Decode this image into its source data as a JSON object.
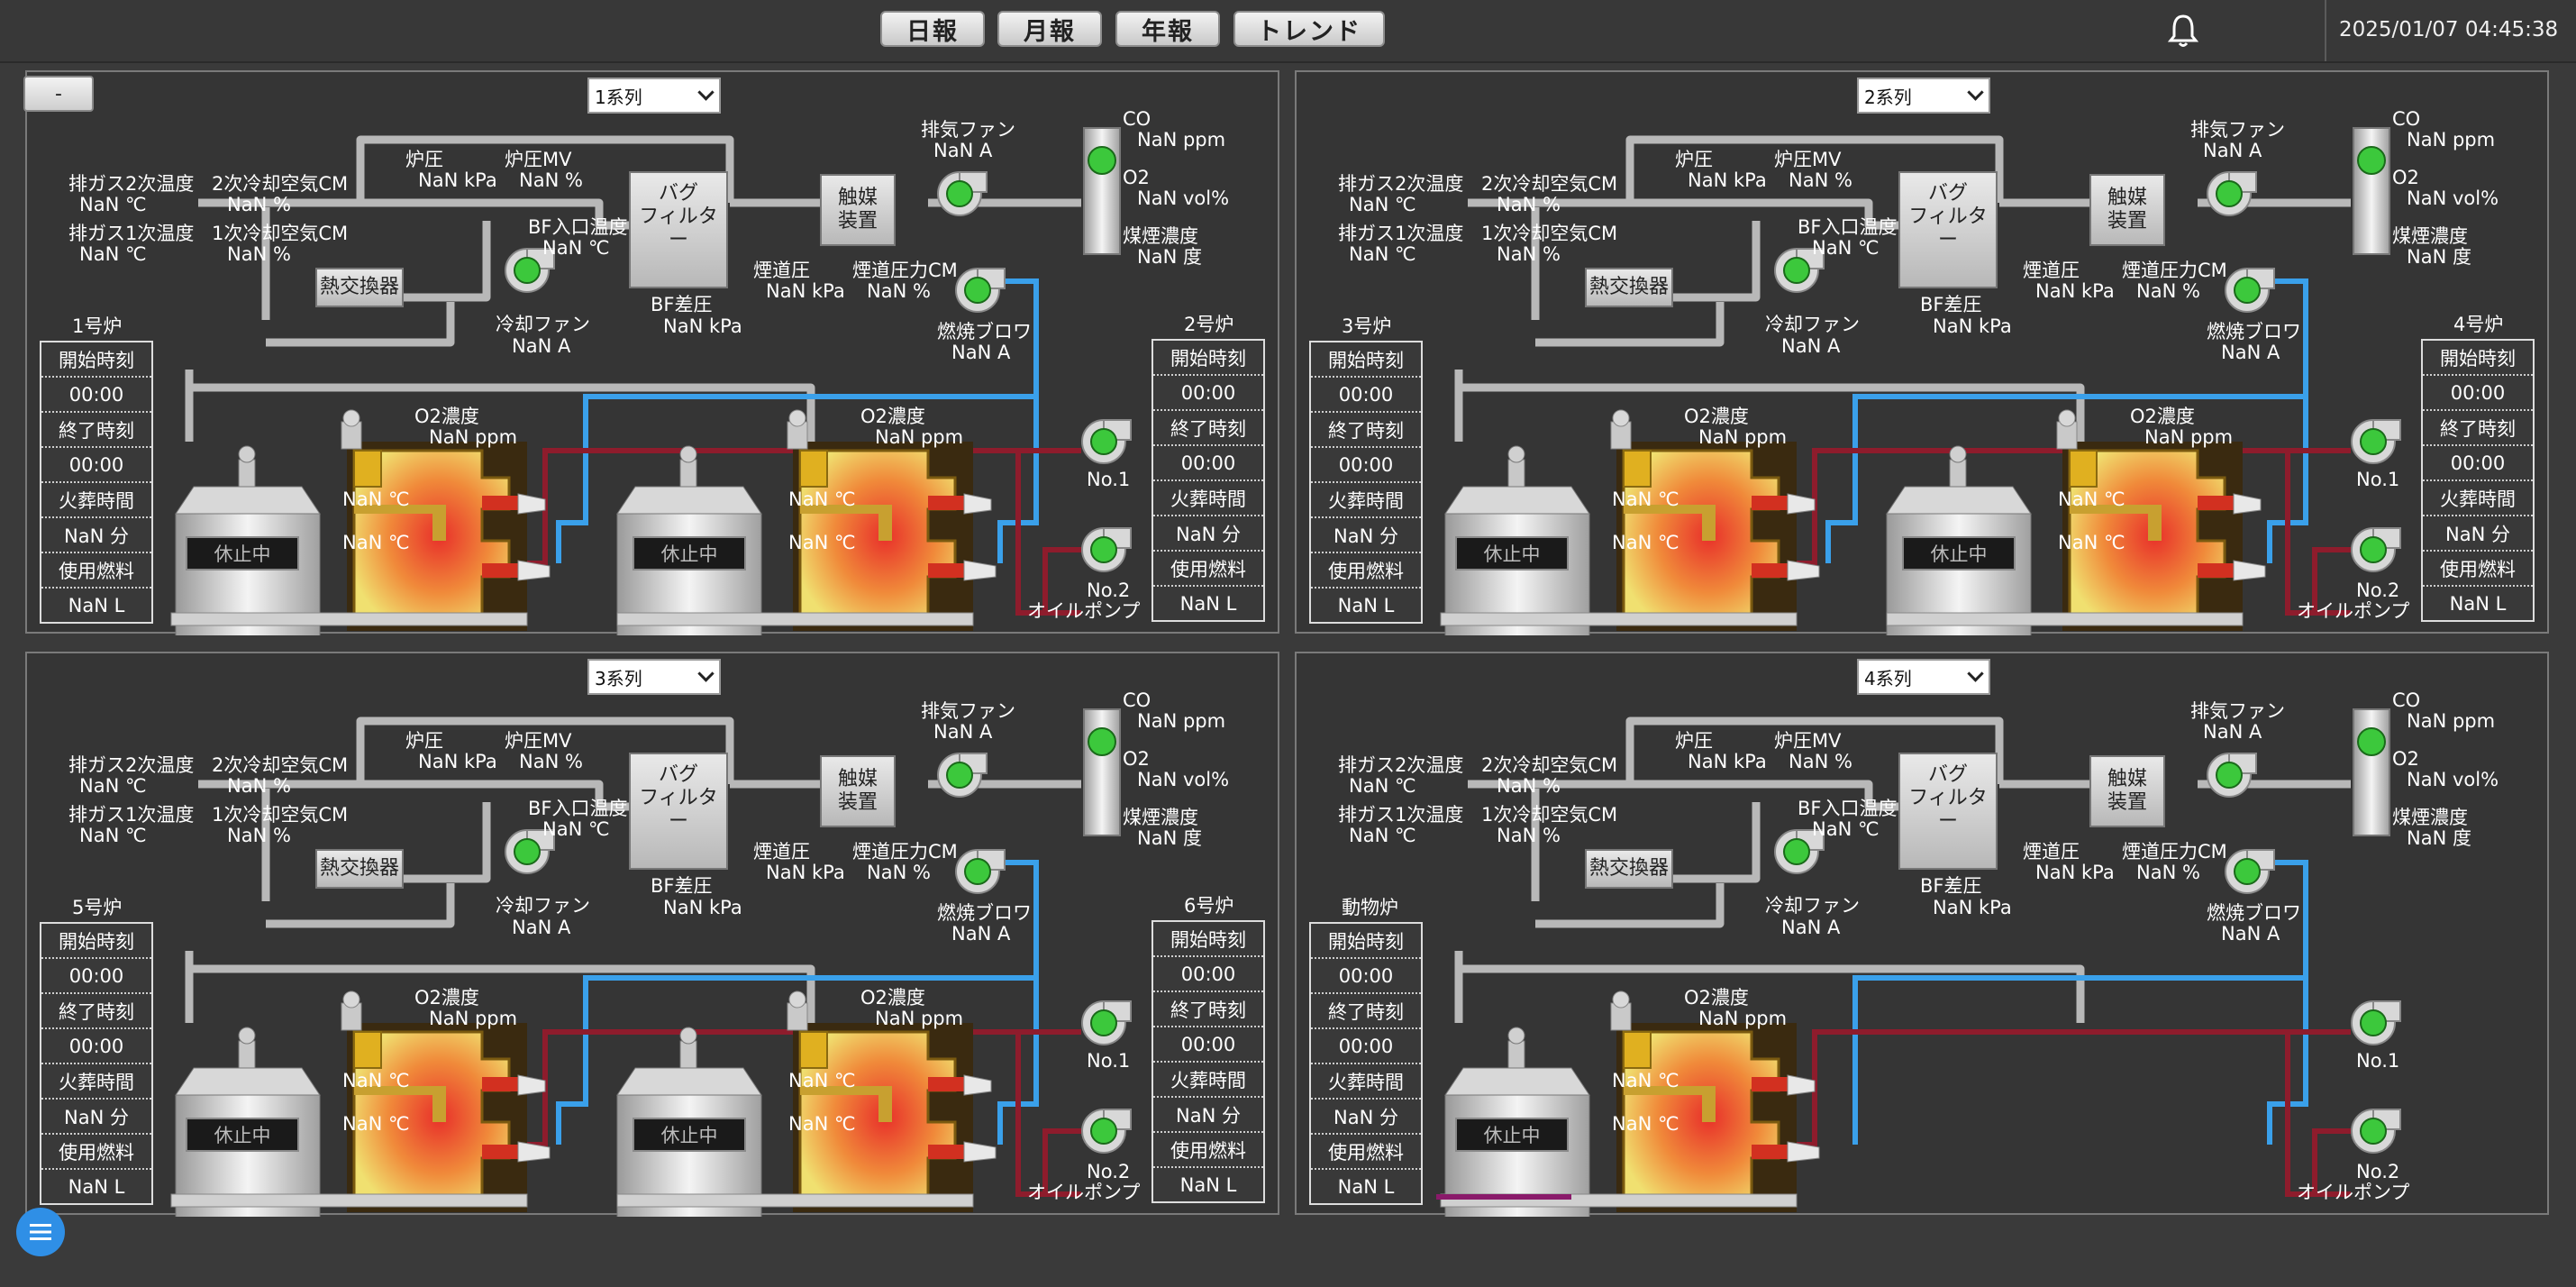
{
  "nav": {
    "daily": "日報",
    "monthly": "月報",
    "yearly": "年報",
    "trend": "トレンド"
  },
  "clock": "2025/01/07 04:45:38",
  "collapse_label": "-",
  "panels": [
    {
      "system": "1系列",
      "left_furnace": "1号炉",
      "right_furnace": "2号炉",
      "has_right_furnace": true
    },
    {
      "system": "2系列",
      "left_furnace": "3号炉",
      "right_furnace": "4号炉",
      "has_right_furnace": true
    },
    {
      "system": "3系列",
      "left_furnace": "5号炉",
      "right_furnace": "6号炉",
      "has_right_furnace": true
    },
    {
      "system": "4系列",
      "left_furnace": "動物炉",
      "right_furnace": "",
      "has_right_furnace": false
    }
  ],
  "labels": {
    "exhaust2_temp": "排ガス2次温度",
    "exhaust1_temp": "排ガス1次温度",
    "cool2_air": "2次冷却空気CM",
    "cool1_air": "1次冷却空気CM",
    "furnace_pressure": "炉圧",
    "furnace_mv": "炉圧MV",
    "bf_inlet_temp": "BF入口温度",
    "bf_diff_pressure": "BF差圧",
    "bag_filter": "バグ\nフィルター",
    "catalyst": "触媒\n装置",
    "heat_exchanger": "熱交換器",
    "exhaust_fan": "排気ファン",
    "cooling_fan": "冷却ファン",
    "flue_pressure": "煙道圧",
    "flue_pressure_cm": "煙道圧力CM",
    "combustion_blower": "燃焼ブロワ",
    "co": "CO",
    "o2": "O2",
    "smoke": "煤煙濃度",
    "o2_conc": "O2濃度",
    "no1": "No.1",
    "no2": "No.2",
    "oil_pump": "オイルポンプ",
    "start_time": "開始時刻",
    "end_time": "終了時刻",
    "burn_time": "火葬時間",
    "fuel": "使用燃料",
    "status_idle": "休止中"
  },
  "values": {
    "temp": "NaN ℃",
    "pct": "NaN %",
    "kpa": "NaN kPa",
    "amp": "NaN A",
    "ppm": "NaN ppm",
    "volpct": "NaN vol%",
    "degree": "NaN 度",
    "time": "00:00",
    "minutes": "NaN 分",
    "liters": "NaN L"
  },
  "colors": {
    "background": "#3a3a3a",
    "duct": "#b8b8b8",
    "air_line": "#3aa0ea",
    "oil_line": "#8e1c2c",
    "status_ok": "#3cc83c"
  }
}
